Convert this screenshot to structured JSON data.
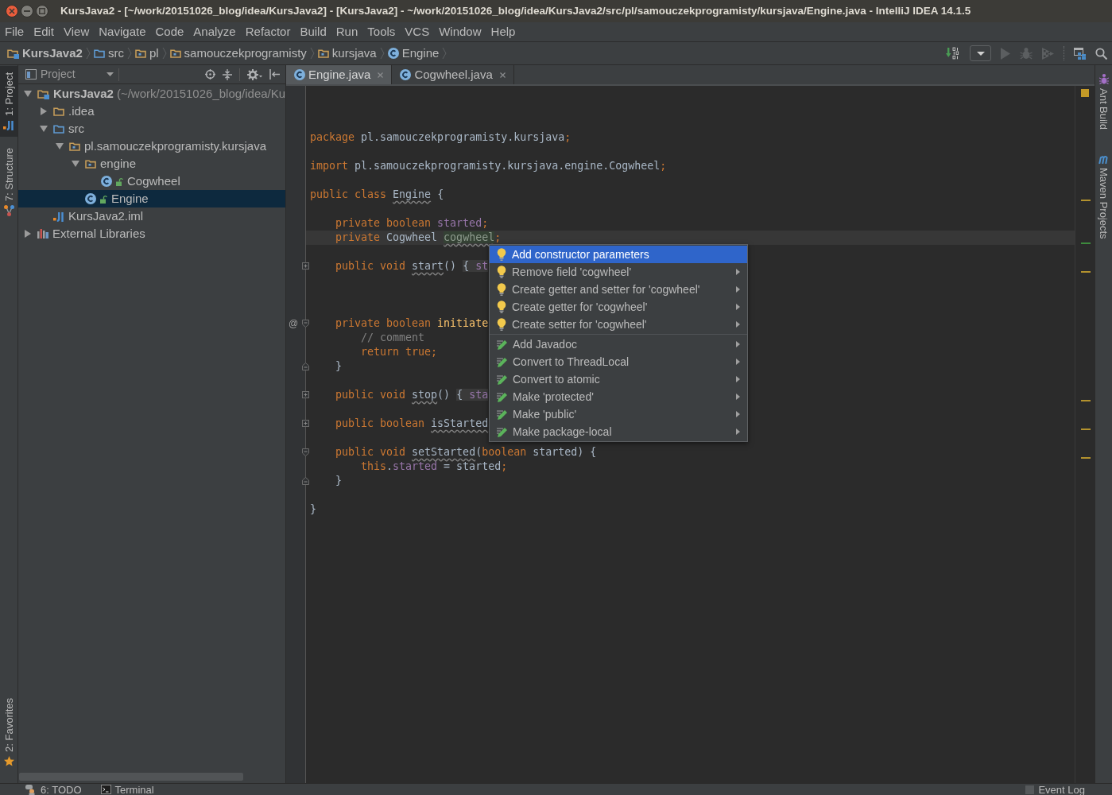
{
  "window": {
    "title": "KursJava2 - [~/work/20151026_blog/idea/KursJava2] - [KursJava2] - ~/work/20151026_blog/idea/KursJava2/src/pl/samouczekprogramisty/kursjava/Engine.java - IntelliJ IDEA 14.1.5"
  },
  "menu": [
    "File",
    "Edit",
    "View",
    "Navigate",
    "Code",
    "Analyze",
    "Refactor",
    "Build",
    "Run",
    "Tools",
    "VCS",
    "Window",
    "Help"
  ],
  "breadcrumbs": [
    {
      "label": "KursJava2",
      "kind": "module"
    },
    {
      "label": "src",
      "kind": "source"
    },
    {
      "label": "pl",
      "kind": "package"
    },
    {
      "label": "samouczekprogramisty",
      "kind": "package"
    },
    {
      "label": "kursjava",
      "kind": "package"
    },
    {
      "label": "Engine",
      "kind": "class"
    }
  ],
  "toolbar": [
    {
      "kind": "make",
      "disabled": false
    },
    {
      "kind": "run_config",
      "disabled": false
    },
    {
      "kind": "run",
      "disabled": true
    },
    {
      "kind": "debug",
      "disabled": true
    },
    {
      "kind": "coverage",
      "disabled": true
    },
    {
      "kind": "structure",
      "disabled": false
    },
    {
      "kind": "search",
      "disabled": false
    }
  ],
  "left_tool_tabs": [
    {
      "label": "1: Project",
      "kind": "project",
      "selected": true
    },
    {
      "label": "7: Structure",
      "kind": "structure",
      "selected": false
    }
  ],
  "left_tool_tabs_bottom": [
    {
      "label": "2: Favorites",
      "kind": "favorites",
      "selected": false
    }
  ],
  "project_panel": {
    "title": "Project",
    "tree": [
      {
        "label": "KursJava2",
        "detail": "(~/work/20151026_blog/idea/Ku",
        "kind": "module",
        "expanded": true,
        "selected": false,
        "children": [
          {
            "label": ".idea",
            "kind": "folder",
            "expanded": false,
            "selected": false
          },
          {
            "label": "src",
            "kind": "source",
            "expanded": true,
            "selected": false,
            "children": [
              {
                "label": "pl.samouczekprogramisty.kursjava",
                "kind": "package",
                "expanded": true,
                "selected": false,
                "children": [
                  {
                    "label": "engine",
                    "kind": "package",
                    "expanded": true,
                    "selected": false,
                    "children": [
                      {
                        "label": "Cogwheel",
                        "kind": "class",
                        "selected": false
                      }
                    ]
                  },
                  {
                    "label": "Engine",
                    "kind": "class",
                    "selected": true
                  }
                ]
              }
            ]
          },
          {
            "label": "KursJava2.iml",
            "kind": "iml",
            "selected": false
          }
        ]
      },
      {
        "label": "External Libraries",
        "kind": "libraries",
        "expanded": false,
        "selected": false
      }
    ]
  },
  "editor": {
    "tabs": [
      {
        "label": "Engine.java",
        "selected": true
      },
      {
        "label": "Cogwheel.java",
        "selected": false
      }
    ],
    "inspection": {
      "color": "#c49a27"
    },
    "lines": [
      {
        "kind": "blank"
      },
      {
        "kind": "blank"
      },
      {
        "kind": "blank"
      },
      {
        "kind": "code",
        "tokens": [
          {
            "text": "package ",
            "kind": "keyword"
          },
          {
            "text": "pl.samouczekprogramisty.kursjava",
            "kind": "plain"
          },
          {
            "text": ";",
            "kind": "keyword"
          }
        ]
      },
      {
        "kind": "blank"
      },
      {
        "kind": "code",
        "tokens": [
          {
            "text": "import ",
            "kind": "keyword"
          },
          {
            "text": "pl.samouczekprogramisty.kursjava.engine.Cogwheel",
            "kind": "plain"
          },
          {
            "text": ";",
            "kind": "keyword"
          }
        ]
      },
      {
        "kind": "blank"
      },
      {
        "kind": "code",
        "color": "#b3922e",
        "tokens": [
          {
            "text": "public class ",
            "kind": "keyword"
          },
          {
            "text": "Engine",
            "kind": "unused"
          },
          {
            "text": " {",
            "kind": "plain"
          }
        ],
        "children": [
          {
            "kind": "blank"
          },
          {
            "kind": "code",
            "tokens": [
              {
                "text": "private boolean ",
                "kind": "keyword"
              },
              {
                "text": "started",
                "kind": "field"
              },
              {
                "text": ";",
                "kind": "keyword"
              }
            ]
          },
          {
            "kind": "code",
            "current": true,
            "color": "#3d8a3d",
            "tokens": [
              {
                "text": "private ",
                "kind": "keyword"
              },
              {
                "text": "Cogwheel ",
                "kind": "plain"
              },
              {
                "text": "cogwheel",
                "kind": "usage"
              },
              {
                "text": ";",
                "kind": "keyword"
              }
            ]
          },
          {
            "kind": "blank"
          },
          {
            "kind": "folded",
            "color": "#b3922e",
            "tokens": [
              {
                "text": "public void ",
                "kind": "keyword"
              },
              {
                "text": "start",
                "kind": "unused"
              },
              {
                "text": "() ",
                "kind": "plain"
              },
              {
                "text": "{ ",
                "kind": "folded"
              },
              {
                "text": "st",
                "kind": "folded_field"
              }
            ]
          },
          {
            "kind": "blank"
          },
          {
            "kind": "blank"
          },
          {
            "kind": "blank"
          },
          {
            "kind": "block",
            "gutter_mark": "@",
            "tokens": [
              {
                "text": "private boolean ",
                "kind": "keyword"
              },
              {
                "text": "initiate",
                "kind": "method"
              }
            ],
            "children": [
              {
                "kind": "code",
                "tokens": [
                  {
                    "text": "// comment",
                    "kind": "comment"
                  }
                ]
              },
              {
                "kind": "code",
                "tokens": [
                  {
                    "text": "return true;",
                    "kind": "keyword"
                  }
                ]
              }
            ]
          },
          {
            "kind": "block_end",
            "tokens": [
              {
                "text": "}",
                "kind": "plain"
              }
            ]
          },
          {
            "kind": "blank"
          },
          {
            "kind": "folded",
            "color": "#b3922e",
            "tokens": [
              {
                "text": "public void ",
                "kind": "keyword"
              },
              {
                "text": "stop",
                "kind": "unused"
              },
              {
                "text": "() ",
                "kind": "plain"
              },
              {
                "text": "{ ",
                "kind": "folded"
              },
              {
                "text": "sta",
                "kind": "folded_field"
              }
            ]
          },
          {
            "kind": "blank"
          },
          {
            "kind": "folded",
            "color": "#b3922e",
            "tokens": [
              {
                "text": "public boolean ",
                "kind": "keyword"
              },
              {
                "text": "isStarted",
                "kind": "unused"
              }
            ]
          },
          {
            "kind": "blank"
          },
          {
            "kind": "block",
            "color": "#b3922e",
            "tokens": [
              {
                "text": "public void ",
                "kind": "keyword"
              },
              {
                "text": "setStarted",
                "kind": "unused"
              },
              {
                "text": "(",
                "kind": "plain"
              },
              {
                "text": "boolean",
                "kind": "keyword"
              },
              {
                "text": " started) {",
                "kind": "plain"
              }
            ],
            "children": [
              {
                "kind": "code",
                "tokens": [
                  {
                    "text": "this",
                    "kind": "keyword"
                  },
                  {
                    "text": ".",
                    "kind": "plain"
                  },
                  {
                    "text": "started",
                    "kind": "field"
                  },
                  {
                    "text": " = started",
                    "kind": "plain"
                  },
                  {
                    "text": ";",
                    "kind": "keyword"
                  }
                ]
              }
            ]
          },
          {
            "kind": "block_end",
            "tokens": [
              {
                "text": "}",
                "kind": "plain"
              }
            ]
          },
          {
            "kind": "blank"
          }
        ]
      },
      {
        "kind": "code",
        "tokens": [
          {
            "text": "}",
            "kind": "plain"
          }
        ]
      }
    ]
  },
  "popup": {
    "groups": [
      {
        "kind": "fix",
        "items": [
          {
            "label": "Add constructor parameters",
            "selected": true,
            "submenu": false
          },
          {
            "label": "Remove field 'cogwheel'",
            "selected": false,
            "submenu": true
          },
          {
            "label": "Create getter and setter for 'cogwheel'",
            "selected": false,
            "submenu": true
          },
          {
            "label": "Create getter for 'cogwheel'",
            "selected": false,
            "submenu": true
          },
          {
            "label": "Create setter for 'cogwheel'",
            "selected": false,
            "submenu": true
          }
        ]
      },
      {
        "kind": "intention",
        "items": [
          {
            "label": "Add Javadoc",
            "selected": false,
            "submenu": true
          },
          {
            "label": "Convert to ThreadLocal",
            "selected": false,
            "submenu": true
          },
          {
            "label": "Convert to atomic",
            "selected": false,
            "submenu": true
          },
          {
            "label": "Make 'protected'",
            "selected": false,
            "submenu": true
          },
          {
            "label": "Make 'public'",
            "selected": false,
            "submenu": true
          },
          {
            "label": "Make package-local",
            "selected": false,
            "submenu": true
          }
        ]
      }
    ]
  },
  "right_tool_tabs": [
    {
      "label": "Ant Build",
      "kind": "ant",
      "selected": false
    },
    {
      "label": "Maven Projects",
      "kind": "maven",
      "selected": false
    }
  ],
  "bottom_tool_tabs": [
    {
      "label": "6: TODO",
      "kind": "todo",
      "selected": false
    },
    {
      "label": "Terminal",
      "kind": "terminal",
      "selected": false
    }
  ],
  "bottom_tool_tabs_right": [
    {
      "label": "Event Log",
      "kind": "event_log",
      "selected": false
    }
  ]
}
